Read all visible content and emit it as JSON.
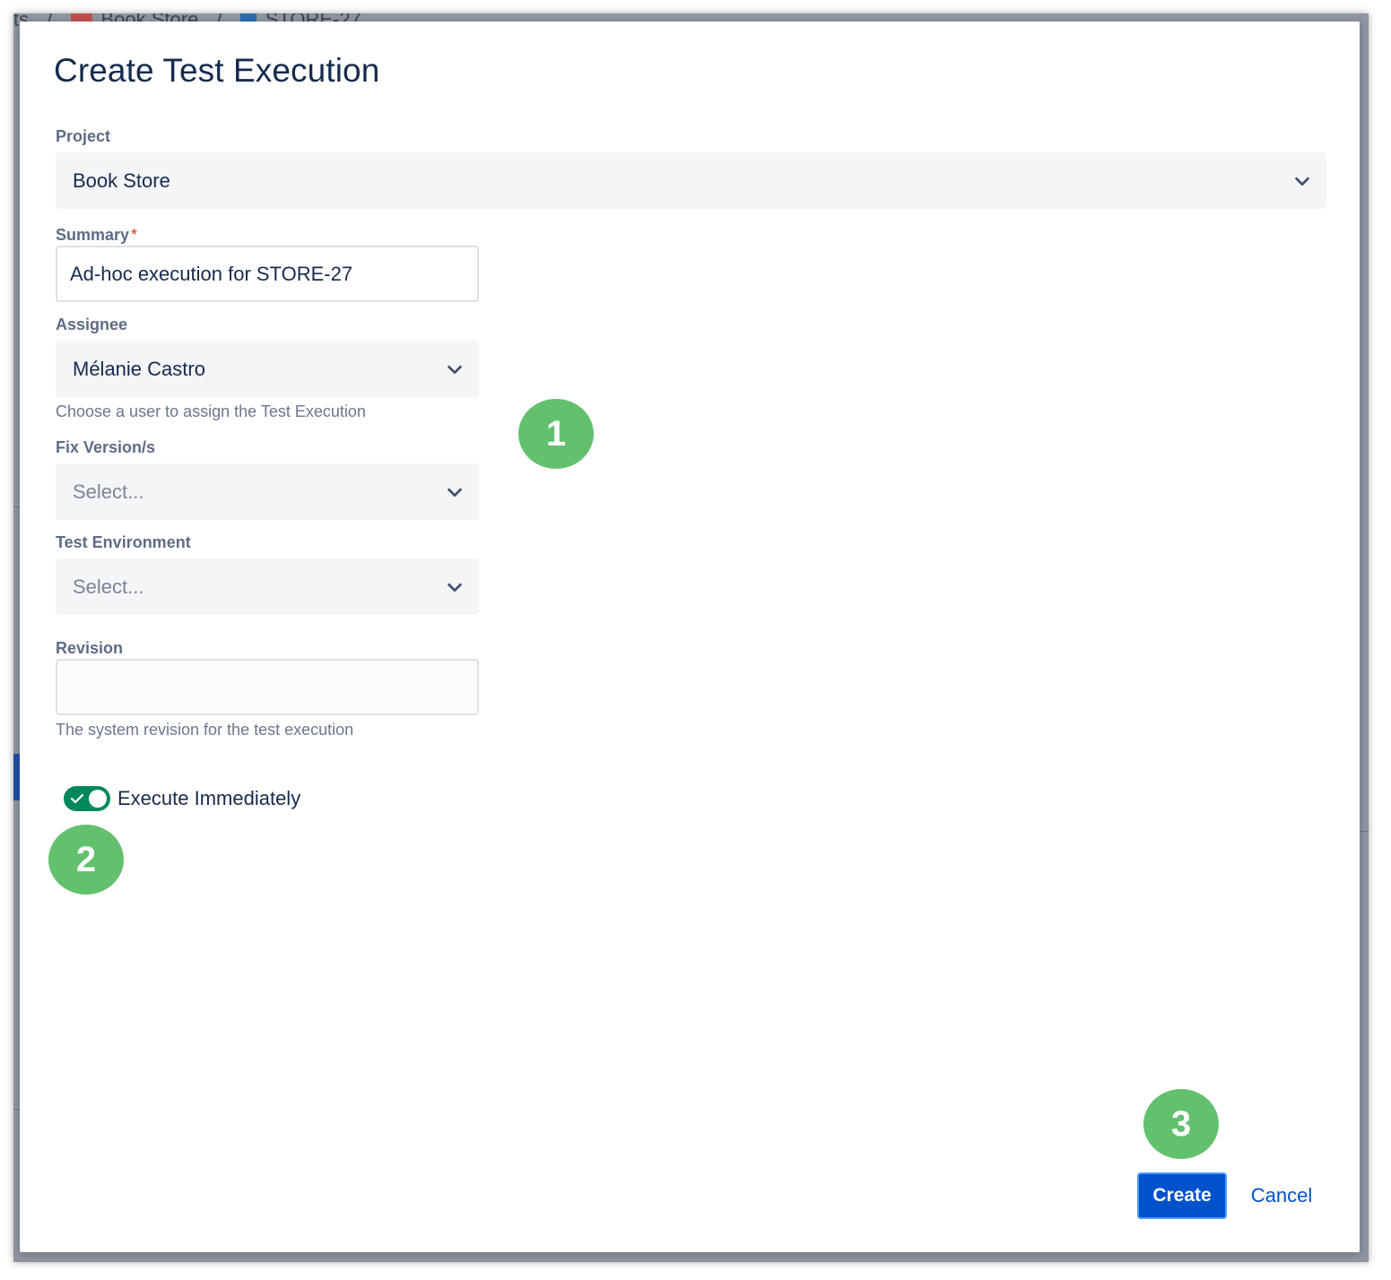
{
  "background": {
    "breadcrumb": {
      "prefix": "ts",
      "sep": "/",
      "project": "Book Store",
      "issue": "STORE-27"
    }
  },
  "dialog": {
    "title": "Create Test Execution",
    "project": {
      "label": "Project",
      "value": "Book Store"
    },
    "summary": {
      "label": "Summary",
      "required_mark": "*",
      "value": "Ad-hoc execution for STORE-27"
    },
    "assignee": {
      "label": "Assignee",
      "value": "Mélanie Castro",
      "help": "Choose a user to assign the Test Execution"
    },
    "fix_version": {
      "label": "Fix Version/s",
      "placeholder": "Select..."
    },
    "test_environment": {
      "label": "Test Environment",
      "placeholder": "Select..."
    },
    "revision": {
      "label": "Revision",
      "value": "",
      "help": "The system revision for the test execution"
    },
    "execute_immediately": {
      "label": "Execute Immediately",
      "checked": true
    },
    "buttons": {
      "create": "Create",
      "cancel": "Cancel"
    }
  },
  "annotations": {
    "one": "1",
    "two": "2",
    "three": "3"
  },
  "colors": {
    "primary": "#0052cc",
    "toggle_on": "#00875a",
    "badge": "#63c16e",
    "backdrop": "#8f96a1"
  }
}
